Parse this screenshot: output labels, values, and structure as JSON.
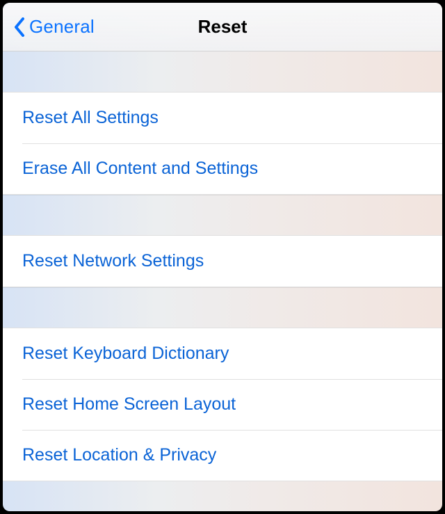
{
  "nav": {
    "back_label": "General",
    "title": "Reset"
  },
  "groups": [
    {
      "items": [
        {
          "label": "Reset All Settings"
        },
        {
          "label": "Erase All Content and Settings"
        }
      ]
    },
    {
      "items": [
        {
          "label": "Reset Network Settings"
        }
      ]
    },
    {
      "items": [
        {
          "label": "Reset Keyboard Dictionary"
        },
        {
          "label": "Reset Home Screen Layout"
        },
        {
          "label": "Reset Location & Privacy"
        }
      ]
    }
  ]
}
